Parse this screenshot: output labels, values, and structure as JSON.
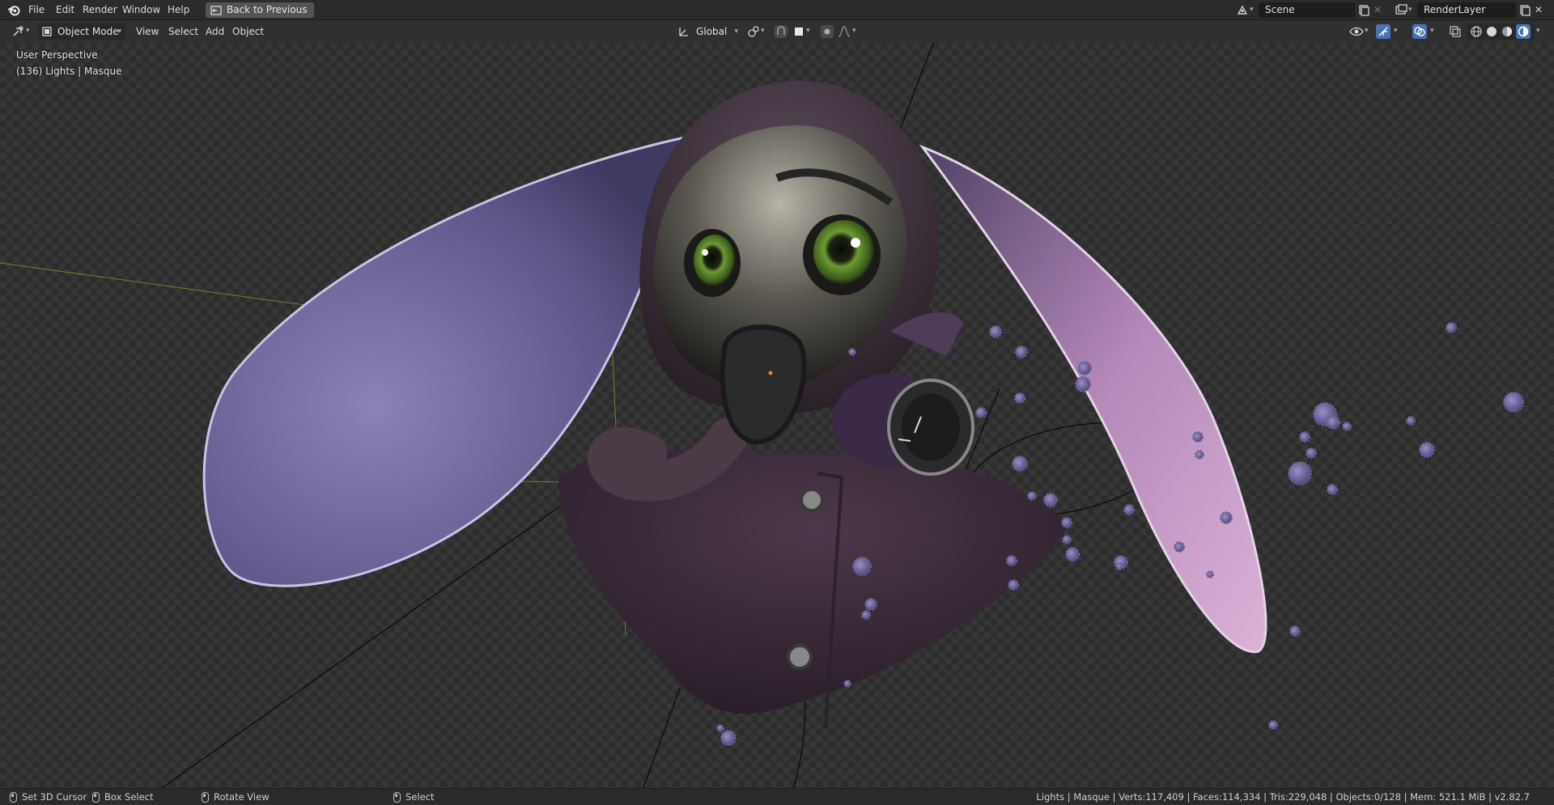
{
  "menu": {
    "items": [
      "File",
      "Edit",
      "Render",
      "Window",
      "Help"
    ],
    "back_button": "Back to Previous"
  },
  "scene_selector": {
    "value": "Scene"
  },
  "render_layer_selector": {
    "value": "RenderLayer"
  },
  "header": {
    "mode": "Object Mode",
    "menus": [
      "View",
      "Select",
      "Add",
      "Object"
    ],
    "transform_orientation": "Global"
  },
  "viewport": {
    "perspective_label": "User Perspective",
    "collection_label": "(136) Lights | Masque"
  },
  "statusbar": {
    "hint_1": "Set 3D Cursor",
    "hint_2": "Box Select",
    "hint_3": "Rotate View",
    "hint_4": "Select",
    "stats": "Lights | Masque | Verts:117,409 | Faces:114,334 | Tris:229,048 | Objects:0/128 | Mem: 521.1 MiB | v2.82.7"
  },
  "icons": [
    "blender-logo-icon",
    "editor-type-icon",
    "object-mode-icon",
    "transform-orientation-icon",
    "pivot-icon",
    "snap-icon",
    "proportional-edit-icon",
    "visibility-icon",
    "gizmo-icon",
    "overlay-icon",
    "xray-icon",
    "shading-wireframe-icon",
    "shading-solid-icon",
    "shading-material-icon",
    "shading-rendered-icon"
  ],
  "colors": {
    "menubar": "#2b2b2b",
    "viewport_bg": "#2d2d2d",
    "accent_blue": "#4772b3",
    "character_ear": "#6d6596",
    "character_ear_right": "#c69ac8",
    "coat": "#3d2c3d",
    "eye_green": "#7fa43c"
  }
}
